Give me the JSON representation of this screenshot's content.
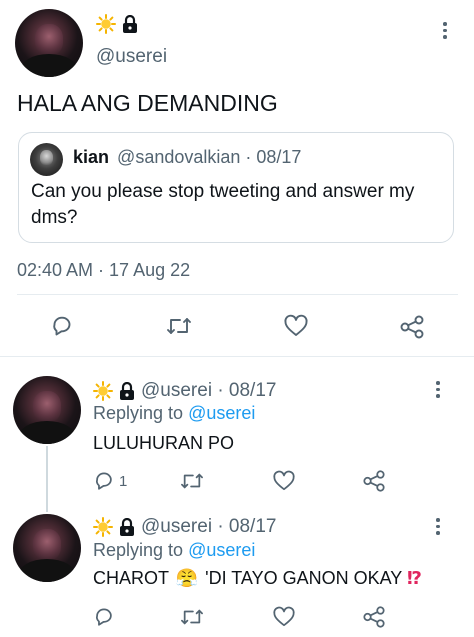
{
  "main_tweet": {
    "handle": "@userei",
    "name_icons": [
      "sun-emoji-icon",
      "lock-icon"
    ],
    "text": "HALA ANG DEMANDING",
    "quote": {
      "name": "kian",
      "handle_date": "@sandovalkian · 08/17",
      "text_line1": "Can you please stop tweeting and answer my",
      "text_line2": "dms?"
    },
    "timestamp": "02:40 AM · 17 Aug 22",
    "actions": [
      "reply-icon",
      "retweet-icon",
      "like-icon",
      "share-icon"
    ]
  },
  "replies": [
    {
      "handle_date": "@userei · 08/17",
      "replying_prefix": "Replying to",
      "replying_to": "@userei",
      "text": "LULUHURAN PO",
      "reply_count": "1"
    },
    {
      "handle_date": "@userei · 08/17",
      "replying_prefix": "Replying to",
      "replying_to": "@userei",
      "text_before": "CHAROT",
      "emoji1": "😤",
      "text_after": "'DI TAYO GANON OKAY",
      "emoji2": "⁉"
    }
  ],
  "colors": {
    "accent": "#1d9bf0",
    "muted": "#536471",
    "text": "#0f1419",
    "emoji_red": "#e0245e"
  }
}
